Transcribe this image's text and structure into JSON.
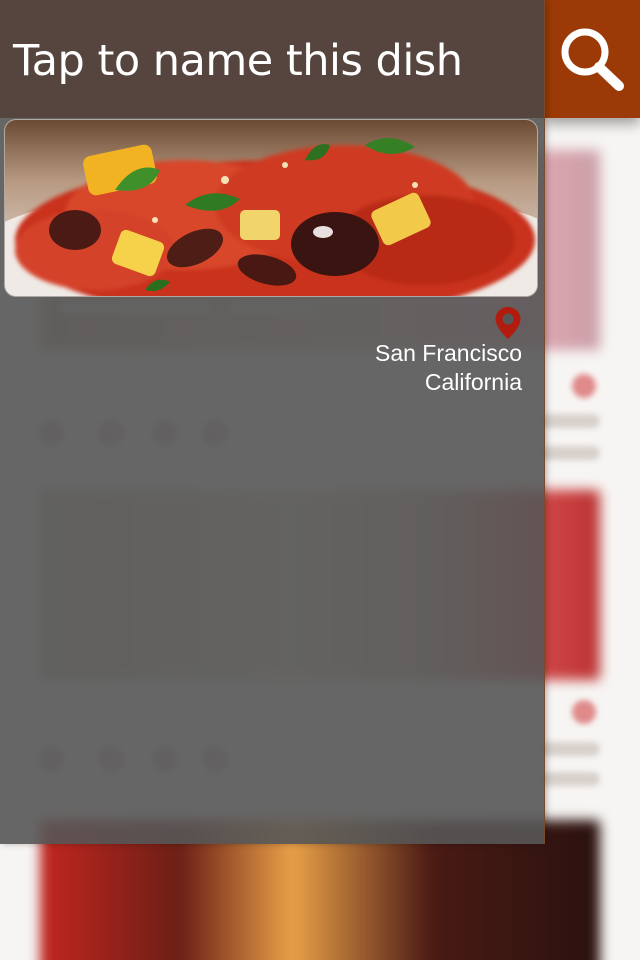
{
  "header": {
    "dish_name_prompt": "Tap to name this dish"
  },
  "search": {
    "icon": "search-icon",
    "color": "#9b3a07"
  },
  "location": {
    "icon": "location-pin-icon",
    "city": "San Francisco",
    "state": "California",
    "pin_color": "#b21c0e"
  },
  "photo": {
    "subject": "pasta with tomato sauce, olives and parsley"
  }
}
